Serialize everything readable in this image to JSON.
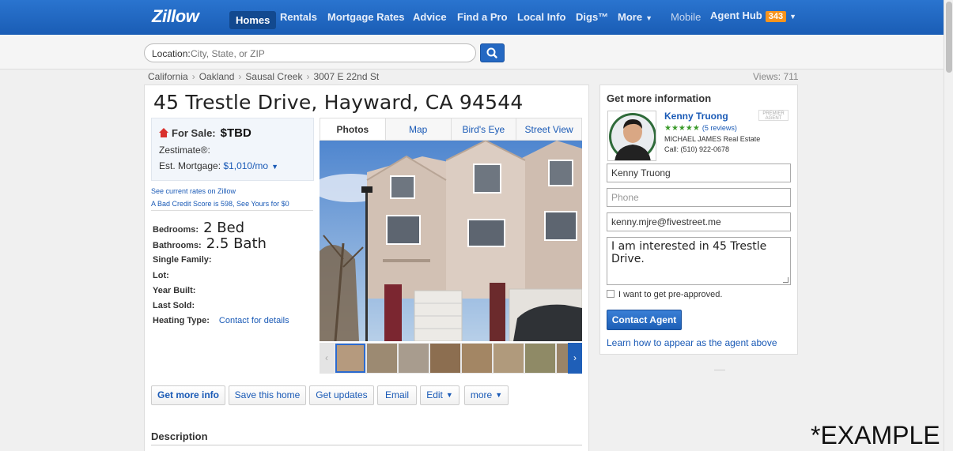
{
  "nav": {
    "logo": "Zillow",
    "items": [
      {
        "label": "Homes",
        "active": true
      },
      {
        "label": "Rentals"
      },
      {
        "label": "Mortgage Rates"
      },
      {
        "label": "Advice"
      },
      {
        "label": "Find a Pro"
      },
      {
        "label": "Local Info"
      },
      {
        "label": "Digs™"
      },
      {
        "label": "More"
      }
    ],
    "mobile": "Mobile",
    "agent_hub": "Agent Hub",
    "agent_hub_count": "343"
  },
  "search": {
    "label": "Location:",
    "placeholder": "City, State, or ZIP"
  },
  "breadcrumb": [
    "California",
    "Oakland",
    "Sausal Creek",
    "3007 E 22nd St"
  ],
  "views": "Views: 711",
  "listing": {
    "title": "45 Trestle Drive, Hayward, CA 94544",
    "for_sale_label": "For Sale:",
    "price": "$TBD",
    "zestimate_label": "Zestimate®:",
    "est_mortgage_label": "Est. Mortgage:",
    "est_mortgage_value": "$1,010/mo",
    "link_rates": "See current rates on Zillow",
    "link_credit": "A Bad Credit Score is 598, See Yours for $0",
    "facts": {
      "bedrooms_label": "Bedrooms:",
      "bedrooms_value": "2 Bed",
      "bathrooms_label": "Bathrooms:",
      "bathrooms_value": "2.5 Bath",
      "single_family_label": "Single Family:",
      "lot_label": "Lot:",
      "year_built_label": "Year Built:",
      "last_sold_label": "Last Sold:",
      "heating_label": "Heating Type:",
      "heating_link": "Contact for details"
    },
    "tabs": [
      "Photos",
      "Map",
      "Bird's Eye",
      "Street View"
    ],
    "actions": [
      "Get more info",
      "Save this home",
      "Get updates",
      "Email",
      "Edit",
      "more"
    ],
    "description_heading": "Description"
  },
  "contact": {
    "heading": "Get more information",
    "agent_name": "Kenny Truong",
    "premier": "PREMIER AGENT",
    "stars": "★★★★★",
    "reviews": "(5 reviews)",
    "firm": "MICHAEL JAMES Real Estate",
    "phone": "Call: (510) 922-0678",
    "name_value": "Kenny Truong",
    "phone_placeholder": "Phone",
    "email_value": "kenny.mjre@fivestreet.me",
    "message_value": "I am interested in 45 Trestle Drive.",
    "preapproved_label": "I want to get pre-approved.",
    "contact_button": "Contact Agent",
    "learn_link": "Learn how to appear as the agent above"
  },
  "watermark": "*EXAMPLE",
  "colors": {
    "nav_blue": "#1d65c0",
    "link_blue": "#1a5ab6",
    "badge_orange": "#f7941d",
    "star_green": "#3a9a2a"
  }
}
